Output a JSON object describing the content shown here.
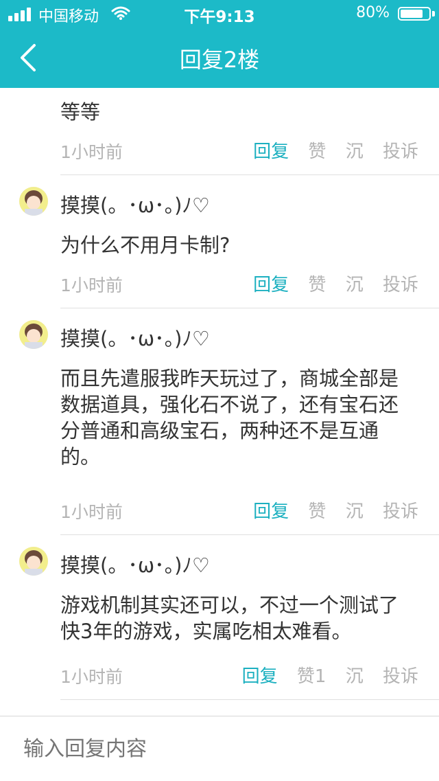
{
  "status_bar": {
    "carrier": "中国移动",
    "time": "下午9:13",
    "battery_percent_text": "80%",
    "battery_level": 0.8
  },
  "header": {
    "title": "回复2楼",
    "background_color": "#1cbac8"
  },
  "comments": [
    {
      "author": "",
      "text": "等等",
      "time": "1小时前",
      "actions": {
        "reply": "回复",
        "like": "赞",
        "sink": "沉",
        "report": "投诉"
      }
    },
    {
      "author": "摸摸(。･ω･。)ﾉ♡",
      "text": "为什么不用月卡制?",
      "time": "1小时前",
      "actions": {
        "reply": "回复",
        "like": "赞",
        "sink": "沉",
        "report": "投诉"
      }
    },
    {
      "author": "摸摸(。･ω･。)ﾉ♡",
      "text_lines": [
        "而且先遣服我昨天玩过了，商城全部是",
        "数据道具，强化石不说了，还有宝石还",
        "分普通和高级宝石，两种还不是互通",
        "的。"
      ],
      "time": "1小时前",
      "actions": {
        "reply": "回复",
        "like": "赞",
        "sink": "沉",
        "report": "投诉"
      }
    },
    {
      "author": "摸摸(。･ω･。)ﾉ♡",
      "text_lines": [
        "游戏机制其实还可以，不过一个测试了",
        "快3年的游戏，实属吃相太难看。"
      ],
      "time": "1小时前",
      "actions": {
        "reply": "回复",
        "like": "赞1",
        "sink": "沉",
        "report": "投诉"
      }
    }
  ],
  "reply_input": {
    "placeholder": "输入回复内容"
  },
  "colors": {
    "accent": "#1cb0c0",
    "muted": "#b4b4b4",
    "text": "#333333"
  }
}
